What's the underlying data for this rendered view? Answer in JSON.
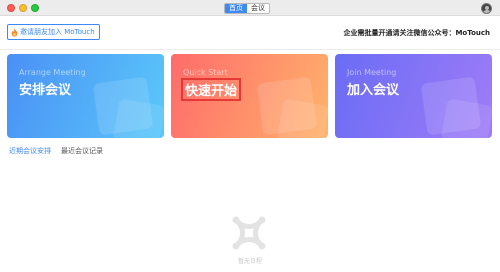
{
  "titlebar": {
    "tabs": [
      {
        "label": "首页",
        "active": true
      },
      {
        "label": "会议",
        "active": false
      }
    ]
  },
  "subbar": {
    "invite_label": "邀请朋友加入 MoTouch",
    "notice": "企业需批量开通请关注微信公众号：MoTouch"
  },
  "cards": [
    {
      "en": "Arrange Meeting",
      "cn": "安排会议"
    },
    {
      "en": "Quick Start",
      "cn": "快速开始"
    },
    {
      "en": "Join Meeting",
      "cn": "加入会议"
    }
  ],
  "meeting_tabs": [
    {
      "label": "近期会议安排",
      "active": true
    },
    {
      "label": "最近会议记录",
      "active": false
    }
  ],
  "empty_state": {
    "text": "暂无日程"
  },
  "colors": {
    "accent": "#3d8af7",
    "card_arrange": "#4a90f5",
    "card_quick": "#ff7a6b",
    "card_join": "#7b6ef6"
  },
  "icons": [
    "fire-icon",
    "avatar",
    "empty-schedule-icon"
  ]
}
